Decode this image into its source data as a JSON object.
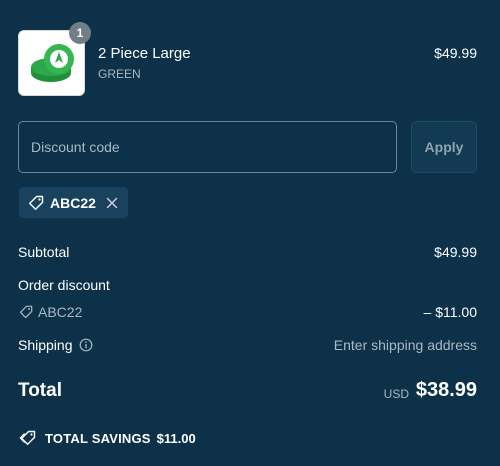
{
  "product": {
    "quantity": "1",
    "title": "2 Piece Large",
    "variant": "GREEN",
    "price": "$49.99"
  },
  "discount": {
    "placeholder": "Discount code",
    "apply_label": "Apply",
    "applied_code": "ABC22"
  },
  "summary": {
    "subtotal_label": "Subtotal",
    "subtotal_value": "$49.99",
    "order_discount_label": "Order discount",
    "discount_code": "ABC22",
    "discount_value": "– $11.00",
    "shipping_label": "Shipping",
    "shipping_value": "Enter shipping address",
    "total_label": "Total",
    "currency": "USD",
    "total_value": "$38.99",
    "savings_label": "TOTAL SAVINGS",
    "savings_value": "$11.00"
  },
  "icons": {
    "tag": "tag-icon",
    "close": "close-icon",
    "info": "info-icon",
    "savings": "savings-tag-icon"
  },
  "colors": {
    "background": "#0c3149",
    "chip": "#19425e",
    "muted_text": "#a9b8c3",
    "product_green": "#2aa84a"
  }
}
